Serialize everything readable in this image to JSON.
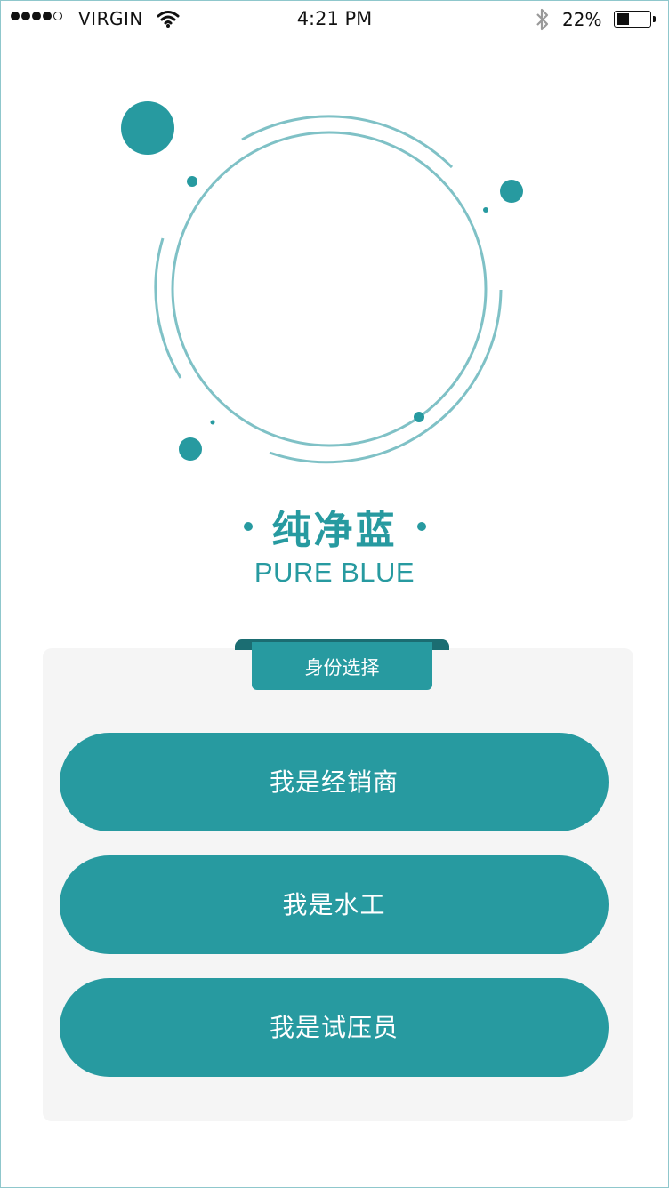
{
  "status_bar": {
    "carrier": "VIRGIN",
    "time": "4:21 PM",
    "battery_percent": "22%",
    "battery_level": 0.22,
    "signal_bars": 4,
    "icons": [
      "signal-dots-icon",
      "wifi-icon",
      "bluetooth-icon",
      "battery-icon"
    ]
  },
  "brand": {
    "title_cn": "纯净蓝",
    "title_en": "PURE BLUE"
  },
  "role_selection": {
    "header": "身份选择",
    "options": [
      {
        "label": "我是经销商"
      },
      {
        "label": "我是水工"
      },
      {
        "label": "我是试压员"
      }
    ]
  },
  "colors": {
    "accent": "#279aa0",
    "accent_dark": "#1b6d72",
    "ring": "#7fc1c6",
    "card_bg": "#f5f5f5"
  }
}
